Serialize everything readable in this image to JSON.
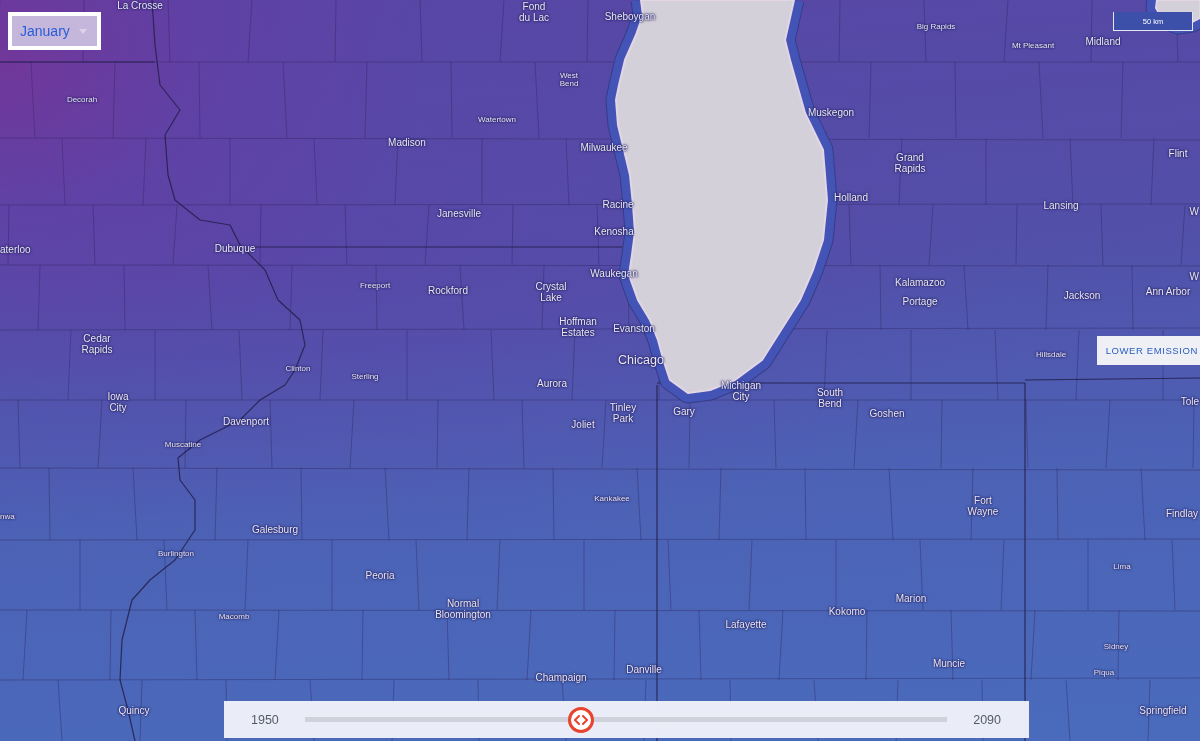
{
  "month_dropdown": {
    "value": "January"
  },
  "map": {
    "place_labels": [
      "La Crosse",
      "Fond\ndu Lac",
      "Sheboygan",
      "Big Rapids",
      "Mt Pleasant",
      "Midland",
      "West\nBend",
      "Decorah",
      "Watertown",
      "Muskegon",
      "Madison",
      "Milwaukee",
      "Grand\nRapids",
      "Flint",
      "Holland",
      "Janesville",
      "Racine",
      "Lansing",
      "W",
      "Kenosha",
      "aterloo",
      "Dubuque",
      "Waukegan",
      "Freeport",
      "Rockford",
      "Crystal\nLake",
      "Kalamazoo",
      "W",
      "Portage",
      "Jackson",
      "Ann Arbor",
      "Cedar\nRapids",
      "Hoffman\nEstates",
      "Evanston",
      "Clinton",
      "Chicago",
      "Hillsdale",
      "Sterling",
      "Aurora",
      "Iowa\nCity",
      "Michigan\nCity",
      "South\nBend",
      "Davenport",
      "Joliet",
      "Tinley\nPark",
      "Gary",
      "Goshen",
      "Tole",
      "Muscatine",
      "Kankakee",
      "nwa",
      "Fort\nWayne",
      "Findlay",
      "Galesburg",
      "Burlington",
      "Peoria",
      "Lima",
      "Macomb",
      "Normal\nBloomington",
      "Marion",
      "Kokomo",
      "Lafayette",
      "Sidney",
      "Champaign",
      "Danville",
      "Muncie",
      "Piqua",
      "Quincy",
      "Springfield"
    ]
  },
  "scale_bar": {
    "label": "50 km"
  },
  "scenario_button": {
    "label": "LOWER EMISSION"
  },
  "time_slider": {
    "start_label": "1950",
    "end_label": "2090",
    "level": 0.43
  }
}
